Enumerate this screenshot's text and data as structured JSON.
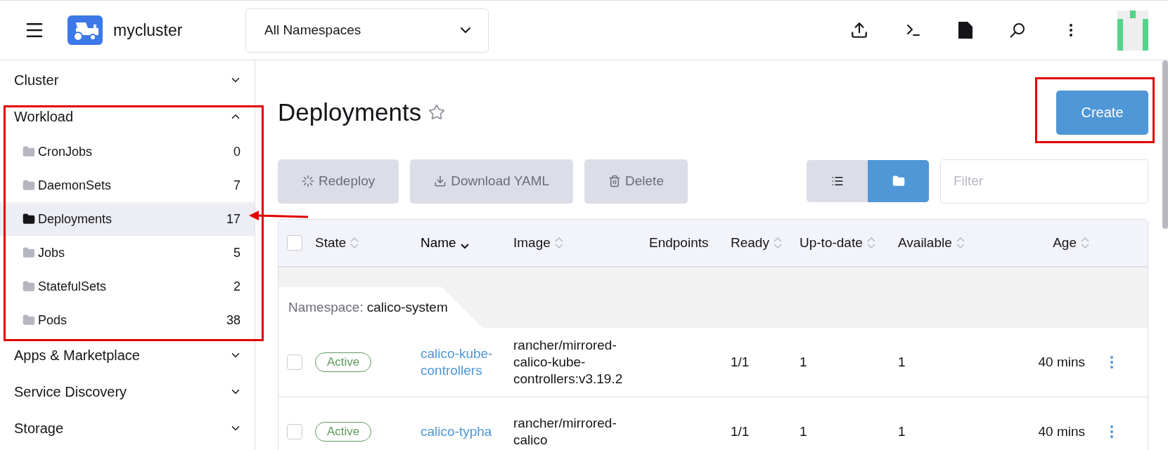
{
  "header": {
    "cluster_name": "mycluster",
    "namespace_select": {
      "value": "All Namespaces"
    }
  },
  "sidebar": {
    "groups": [
      {
        "label": "Cluster",
        "expanded": false
      },
      {
        "label": "Workload",
        "expanded": true,
        "items": [
          {
            "label": "CronJobs",
            "count": "0",
            "selected": false
          },
          {
            "label": "DaemonSets",
            "count": "7",
            "selected": false
          },
          {
            "label": "Deployments",
            "count": "17",
            "selected": true
          },
          {
            "label": "Jobs",
            "count": "5",
            "selected": false
          },
          {
            "label": "StatefulSets",
            "count": "2",
            "selected": false
          },
          {
            "label": "Pods",
            "count": "38",
            "selected": false
          }
        ]
      },
      {
        "label": "Apps & Marketplace",
        "expanded": false
      },
      {
        "label": "Service Discovery",
        "expanded": false
      },
      {
        "label": "Storage",
        "expanded": false
      }
    ]
  },
  "page": {
    "title": "Deployments",
    "favorite": false,
    "create_button": "Create"
  },
  "toolbar": {
    "actions": [
      {
        "kind": "redeploy",
        "label": "Redeploy",
        "disabled": true
      },
      {
        "kind": "download",
        "label": "Download YAML",
        "disabled": true
      },
      {
        "kind": "delete",
        "label": "Delete",
        "disabled": true
      }
    ],
    "view_toggle": [
      {
        "kind": "list",
        "selected": false
      },
      {
        "kind": "folder",
        "selected": true
      }
    ],
    "filter": {
      "placeholder": "Filter"
    }
  },
  "table": {
    "select_all_checked": false,
    "columns": [
      {
        "label": "State",
        "sortable": true,
        "sorted": false
      },
      {
        "label": "Name",
        "sortable": true,
        "sorted": true
      },
      {
        "label": "Image",
        "sortable": true,
        "sorted": false
      },
      {
        "label": "Endpoints",
        "sortable": false,
        "sorted": false
      },
      {
        "label": "Ready",
        "sortable": true,
        "sorted": false
      },
      {
        "label": "Up-to-date",
        "sortable": true,
        "sorted": false
      },
      {
        "label": "Available",
        "sortable": true,
        "sorted": false
      },
      {
        "label": "Age",
        "sortable": true,
        "sorted": false
      }
    ],
    "groups": [
      {
        "label": "Namespace:",
        "namespace": "calico-system",
        "rows": [
          {
            "checked": false,
            "state": "Active",
            "name": "calico-kube-controllers",
            "image": "rancher/mirrored-calico-kube-controllers:v3.19.2",
            "ready": "1/1",
            "up_to_date": "1",
            "available": "1",
            "age": "40 mins"
          },
          {
            "checked": false,
            "state": "Active",
            "name": "calico-typha",
            "image": "rancher/mirrored-calico",
            "ready": "1/1",
            "up_to_date": "1",
            "available": "1",
            "age": "40 mins"
          }
        ]
      }
    ]
  }
}
